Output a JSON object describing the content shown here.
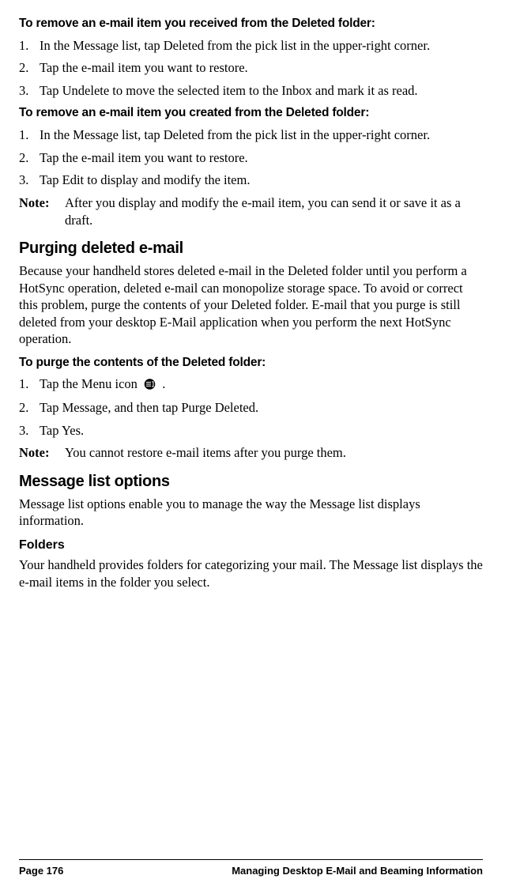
{
  "section1": {
    "heading": "To remove an e-mail item you received from the Deleted folder:",
    "steps": [
      "In the Message list, tap Deleted from the pick list in the upper-right corner.",
      "Tap the e-mail item you want to restore.",
      "Tap Undelete to move the selected item to the Inbox and mark it as read."
    ]
  },
  "section2": {
    "heading": "To remove an e-mail item you created from the Deleted folder:",
    "steps": [
      "In the Message list, tap Deleted from the pick list in the upper-right corner.",
      "Tap the e-mail item you want to restore.",
      "Tap Edit to display and modify the item."
    ],
    "note_label": "Note:",
    "note_body": "After you display and modify the e-mail item, you can send it or save it as a draft."
  },
  "section3": {
    "heading": "Purging deleted e-mail",
    "body": "Because your handheld stores deleted e-mail in the Deleted folder until you perform a HotSync operation, deleted e-mail can monopolize storage space. To avoid or correct this problem, purge the contents of your Deleted folder. E-mail that you purge is still deleted from your desktop E-Mail application when you perform the next HotSync operation.",
    "sub_heading": "To purge the contents of the Deleted folder:",
    "step1_pre": "Tap the Menu icon ",
    "step1_post": " .",
    "step2": "Tap Message, and then tap Purge Deleted.",
    "step3": "Tap Yes.",
    "note_label": "Note:",
    "note_body": "You cannot restore e-mail items after you purge them."
  },
  "section4": {
    "heading": "Message list options",
    "body": "Message list options enable you to manage the way the Message list displays information.",
    "sub_heading": "Folders",
    "sub_body": "Your handheld provides folders for categorizing your mail. The Message list displays the e-mail items in the folder you select."
  },
  "footer": {
    "page": "Page 176",
    "chapter": "Managing Desktop E-Mail and Beaming Information"
  }
}
